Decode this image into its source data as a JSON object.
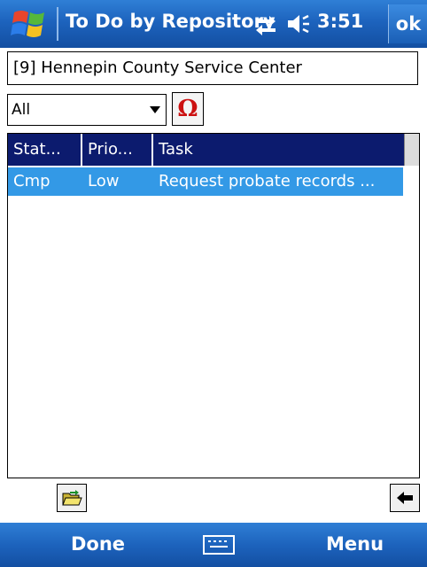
{
  "titlebar": {
    "title": "To Do by Repository",
    "time": "3:51",
    "ok_label": "ok",
    "icons": [
      "windows-start-icon",
      "connectivity-icon",
      "volume-icon"
    ]
  },
  "repository": {
    "value": "[9] Hennepin County Service Center"
  },
  "filter": {
    "selected": "All",
    "omega_symbol": "Ω"
  },
  "list": {
    "columns": [
      "Stat...",
      "Prio...",
      "Task"
    ],
    "rows": [
      {
        "status": "Cmp",
        "priority": "Low",
        "task": "Request probate records ..."
      }
    ],
    "selected_row_color": "#3399e6",
    "header_color": "#0c1b6e"
  },
  "toolbar": {
    "icons": [
      "open-folder-icon",
      "back-arrow-icon"
    ]
  },
  "softkeys": {
    "left": "Done",
    "right": "Menu",
    "center_icon": "keyboard-icon"
  }
}
